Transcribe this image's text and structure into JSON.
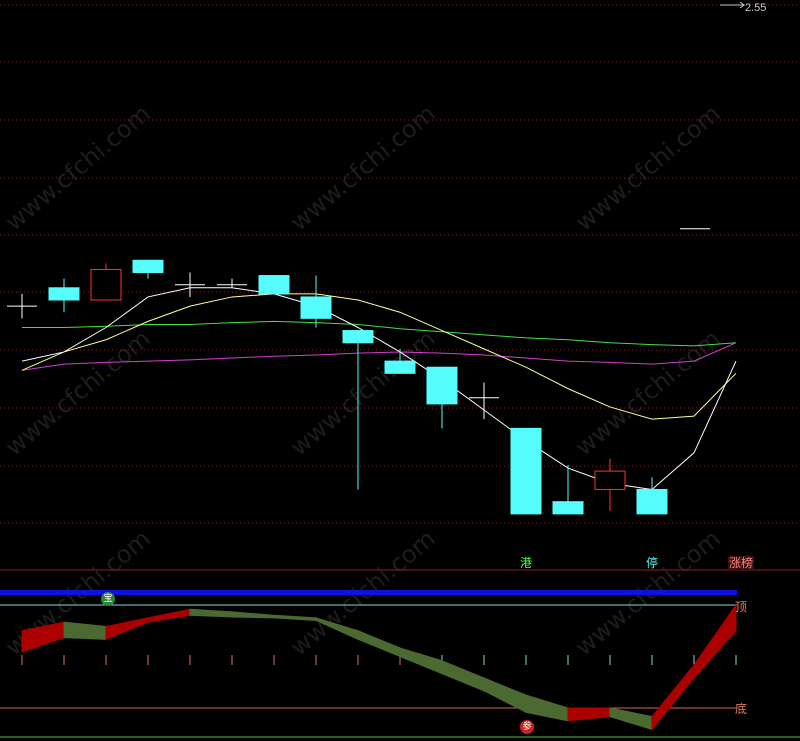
{
  "price_tag": "2.55",
  "watermark": "www.cfchi.com",
  "signals": {
    "gang": "港",
    "ting": "停",
    "zhangbang": "涨榜"
  },
  "side_labels": {
    "top": "顶",
    "bottom": "底"
  },
  "badges": {
    "bao": "宝",
    "can": "参"
  },
  "colors": {
    "background": "#000000",
    "candle_down": "#54fcfc",
    "candle_up": "#ff3232",
    "ma_short": "#ffffff",
    "ma_mid": "#ffff9a",
    "ma_long": "#42e042",
    "ma_extra": "#d040d0",
    "grid": "#8a2020",
    "band_up": "#aa0000",
    "band_down": "#4a6a32",
    "blue_bar": "#1010e0"
  },
  "chart_data": {
    "type": "candlestick",
    "candles": [
      {
        "open": 0.0,
        "close": 0.0,
        "high": 0.2,
        "low": -0.2
      },
      {
        "open": 0.3,
        "close": 0.1,
        "high": 0.45,
        "low": -0.1
      },
      {
        "open": 0.1,
        "close": 0.6,
        "high": 0.7,
        "low": 0.1
      },
      {
        "open": 0.75,
        "close": 0.55,
        "high": 0.75,
        "low": 0.45
      },
      {
        "open": 0.35,
        "close": 0.35,
        "high": 0.55,
        "low": 0.15
      },
      {
        "open": 0.35,
        "close": 0.35,
        "high": 0.45,
        "low": 0.3
      },
      {
        "open": 0.5,
        "close": 0.2,
        "high": 0.5,
        "low": 0.2
      },
      {
        "open": 0.15,
        "close": -0.2,
        "high": 0.5,
        "low": -0.35
      },
      {
        "open": -0.4,
        "close": -0.6,
        "high": -0.4,
        "low": -3.0
      },
      {
        "open": -0.9,
        "close": -1.1,
        "high": -0.7,
        "low": -1.1
      },
      {
        "open": -1.0,
        "close": -1.6,
        "high": -1.0,
        "low": -2.0
      },
      {
        "open": -1.5,
        "close": -1.5,
        "high": -1.25,
        "low": -1.85
      },
      {
        "open": -2.0,
        "close": -3.4,
        "high": -2.0,
        "low": -3.4
      },
      {
        "open": -3.2,
        "close": -3.4,
        "high": -2.6,
        "low": -3.4
      },
      {
        "open": -3.0,
        "close": -2.7,
        "high": -2.5,
        "low": -3.35
      },
      {
        "open": -3.0,
        "close": -3.4,
        "high": -2.8,
        "low": -3.4
      }
    ],
    "ma_short": [
      -0.9,
      -0.75,
      -0.35,
      0.15,
      0.3,
      0.3,
      0.2,
      0.0,
      -0.35,
      -0.75,
      -1.2,
      -1.7,
      -2.2,
      -2.65,
      -2.9,
      -3.0,
      -2.4,
      -0.9
    ],
    "ma_mid": [
      -1.05,
      -0.75,
      -0.55,
      -0.25,
      0.0,
      0.15,
      0.2,
      0.2,
      0.1,
      -0.1,
      -0.4,
      -0.7,
      -1.0,
      -1.35,
      -1.65,
      -1.85,
      -1.8,
      -1.1
    ],
    "ma_long": [
      -0.35,
      -0.35,
      -0.33,
      -0.3,
      -0.3,
      -0.27,
      -0.25,
      -0.27,
      -0.3,
      -0.37,
      -0.42,
      -0.47,
      -0.52,
      -0.55,
      -0.6,
      -0.63,
      -0.65,
      -0.6
    ],
    "ma_extra": [
      -1.05,
      -0.95,
      -0.92,
      -0.9,
      -0.88,
      -0.85,
      -0.82,
      -0.8,
      -0.77,
      -0.75,
      -0.77,
      -0.8,
      -0.85,
      -0.9,
      -0.92,
      -0.95,
      -0.9,
      -0.6
    ],
    "ref_line_value": 0.35,
    "indicator": {
      "band_upper": [
        0.7,
        0.8,
        0.75,
        0.85,
        0.95,
        0.92,
        0.88,
        0.85,
        0.7,
        0.5,
        0.35,
        0.15,
        -0.05,
        -0.2,
        -0.2,
        -0.3,
        0.3,
        1.0
      ],
      "band_lower": [
        0.45,
        0.62,
        0.6,
        0.8,
        0.88,
        0.86,
        0.85,
        0.82,
        0.6,
        0.4,
        0.2,
        0.0,
        -0.25,
        -0.35,
        -0.3,
        -0.45,
        0.15,
        0.7
      ],
      "top_level": 1.0,
      "bottom_level": -0.2
    }
  }
}
